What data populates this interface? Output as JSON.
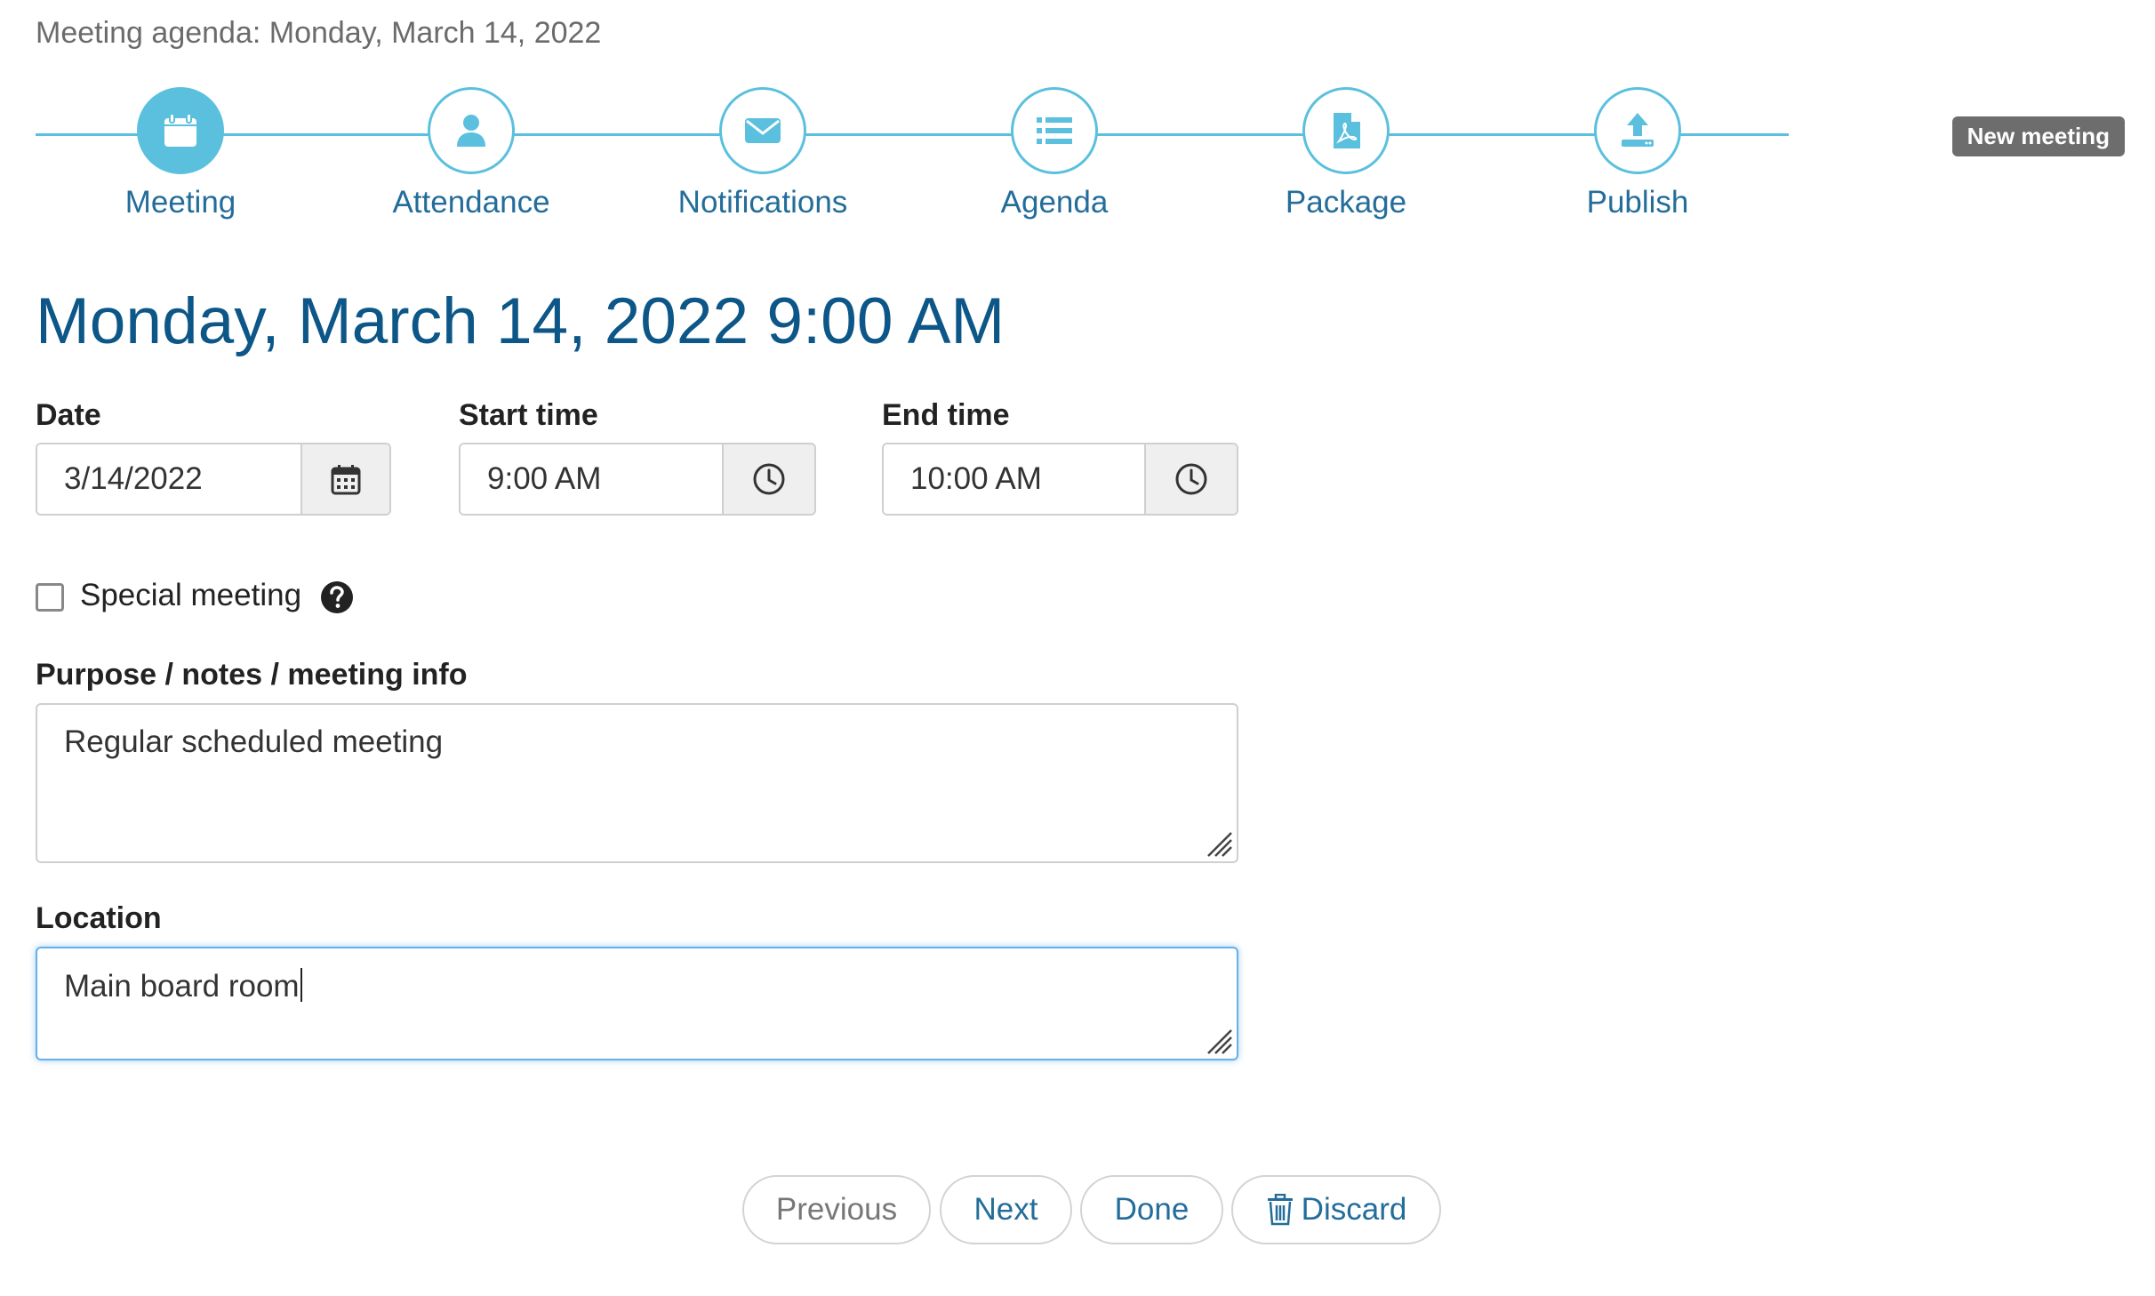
{
  "header": {
    "caption": "Meeting agenda: Monday, March 14, 2022",
    "badge": "New meeting"
  },
  "steps": [
    {
      "label": "Meeting",
      "icon": "calendar-icon",
      "active": true
    },
    {
      "label": "Attendance",
      "icon": "user-icon",
      "active": false
    },
    {
      "label": "Notifications",
      "icon": "envelope-icon",
      "active": false
    },
    {
      "label": "Agenda",
      "icon": "list-icon",
      "active": false
    },
    {
      "label": "Package",
      "icon": "pdf-file-icon",
      "active": false
    },
    {
      "label": "Publish",
      "icon": "upload-icon",
      "active": false
    }
  ],
  "colors": {
    "accent": "#5bc0de",
    "title": "#0c5688",
    "link": "#236d9a",
    "badge": "#6d6d6d"
  },
  "main": {
    "title": "Monday, March 14, 2022 9:00 AM"
  },
  "form": {
    "date": {
      "label": "Date",
      "value": "3/14/2022"
    },
    "start": {
      "label": "Start time",
      "value": "9:00 AM"
    },
    "end": {
      "label": "End time",
      "value": "10:00 AM"
    },
    "special": {
      "label": "Special meeting",
      "checked": false
    },
    "purpose": {
      "label": "Purpose / notes / meeting info",
      "value": "Regular scheduled meeting"
    },
    "location": {
      "label": "Location",
      "value": "Main board room"
    }
  },
  "buttons": {
    "previous": "Previous",
    "next": "Next",
    "done": "Done",
    "discard": "Discard"
  }
}
